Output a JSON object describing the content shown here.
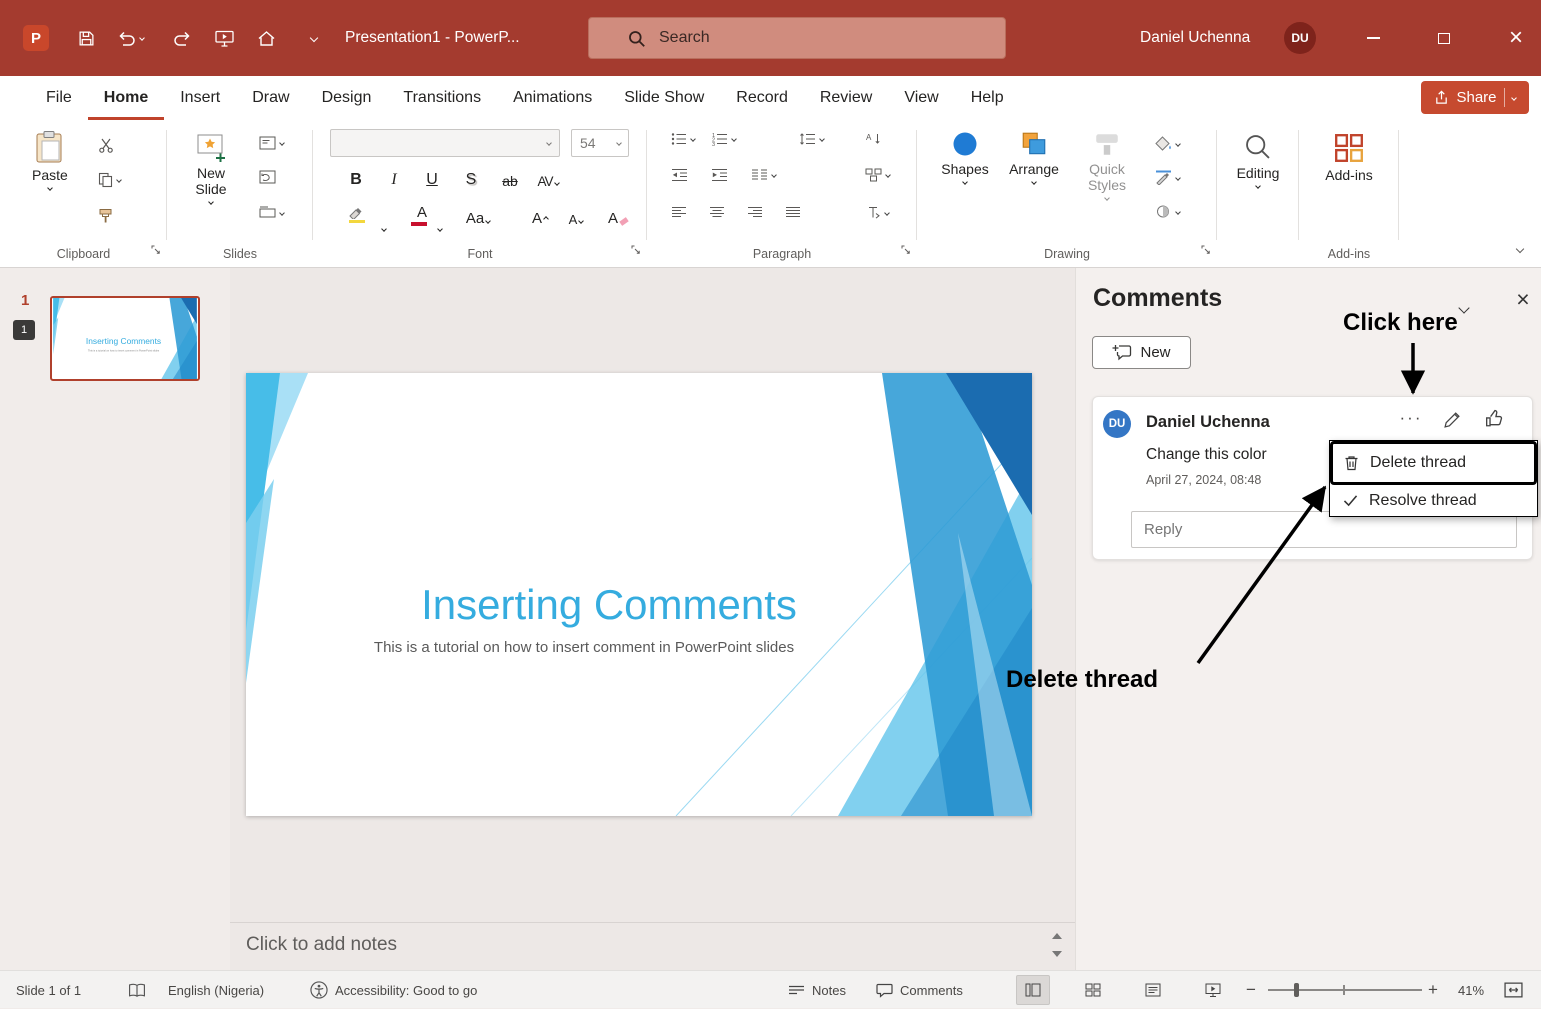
{
  "colors": {
    "titlebar": "#A43B2F",
    "accent_red": "#C0432B",
    "slide_blue": "#35ACDF",
    "avatar_blue": "#3476C5"
  },
  "icons": {
    "close": "×",
    "zoom_in": "+",
    "zoom_out": "−"
  },
  "titlebar": {
    "app_name": "P",
    "title": "Presentation1  -  PowerP...",
    "search_placeholder": "Search",
    "user_name": "Daniel Uchenna",
    "user_initials": "DU"
  },
  "menubar": {
    "tabs": [
      "File",
      "Home",
      "Insert",
      "Draw",
      "Design",
      "Transitions",
      "Animations",
      "Slide Show",
      "Record",
      "Review",
      "View",
      "Help"
    ],
    "share": "Share"
  },
  "ribbon": {
    "paste": "Paste",
    "new_slide": "New Slide",
    "font_size": "54",
    "bold": "B",
    "italic": "I",
    "underline": "U",
    "shadow": "S",
    "ab": "ab",
    "char_spacing": "AV",
    "change_case": "Aa",
    "font_color": "A",
    "grow_font": "A",
    "shrink_font": "A",
    "clear_format": "A",
    "shapes": "Shapes",
    "arrange": "Arrange",
    "quick_styles": "Quick Styles",
    "editing": "Editing",
    "addins_button": "Add-ins",
    "groups": {
      "clipboard": "Clipboard",
      "slides": "Slides",
      "font": "Font",
      "paragraph": "Paragraph",
      "drawing": "Drawing",
      "addins": "Add-ins"
    }
  },
  "thumbnails": {
    "slide_number": "1",
    "comment_badge": "1"
  },
  "slide": {
    "title": "Inserting Comments",
    "subtitle": "This is a tutorial on how to insert comment in PowerPoint slides"
  },
  "notes": {
    "placeholder": "Click to add notes"
  },
  "comments": {
    "panel_title": "Comments",
    "new_button": "New",
    "overflow": "···",
    "thread": {
      "initials": "DU",
      "author": "Daniel Uchenna",
      "body": "Change this color",
      "timestamp": "April 27, 2024, 08:48",
      "reply_placeholder": "Reply"
    },
    "context_menu": {
      "delete": "Delete thread",
      "resolve": "Resolve thread"
    }
  },
  "annotations": {
    "click_here": "Click here",
    "delete_thread": "Delete thread"
  },
  "statusbar": {
    "slide_indicator": "Slide 1 of 1",
    "language": "English (Nigeria)",
    "accessibility": "Accessibility: Good to go",
    "notes": "Notes",
    "comments": "Comments",
    "zoom": "41%"
  }
}
